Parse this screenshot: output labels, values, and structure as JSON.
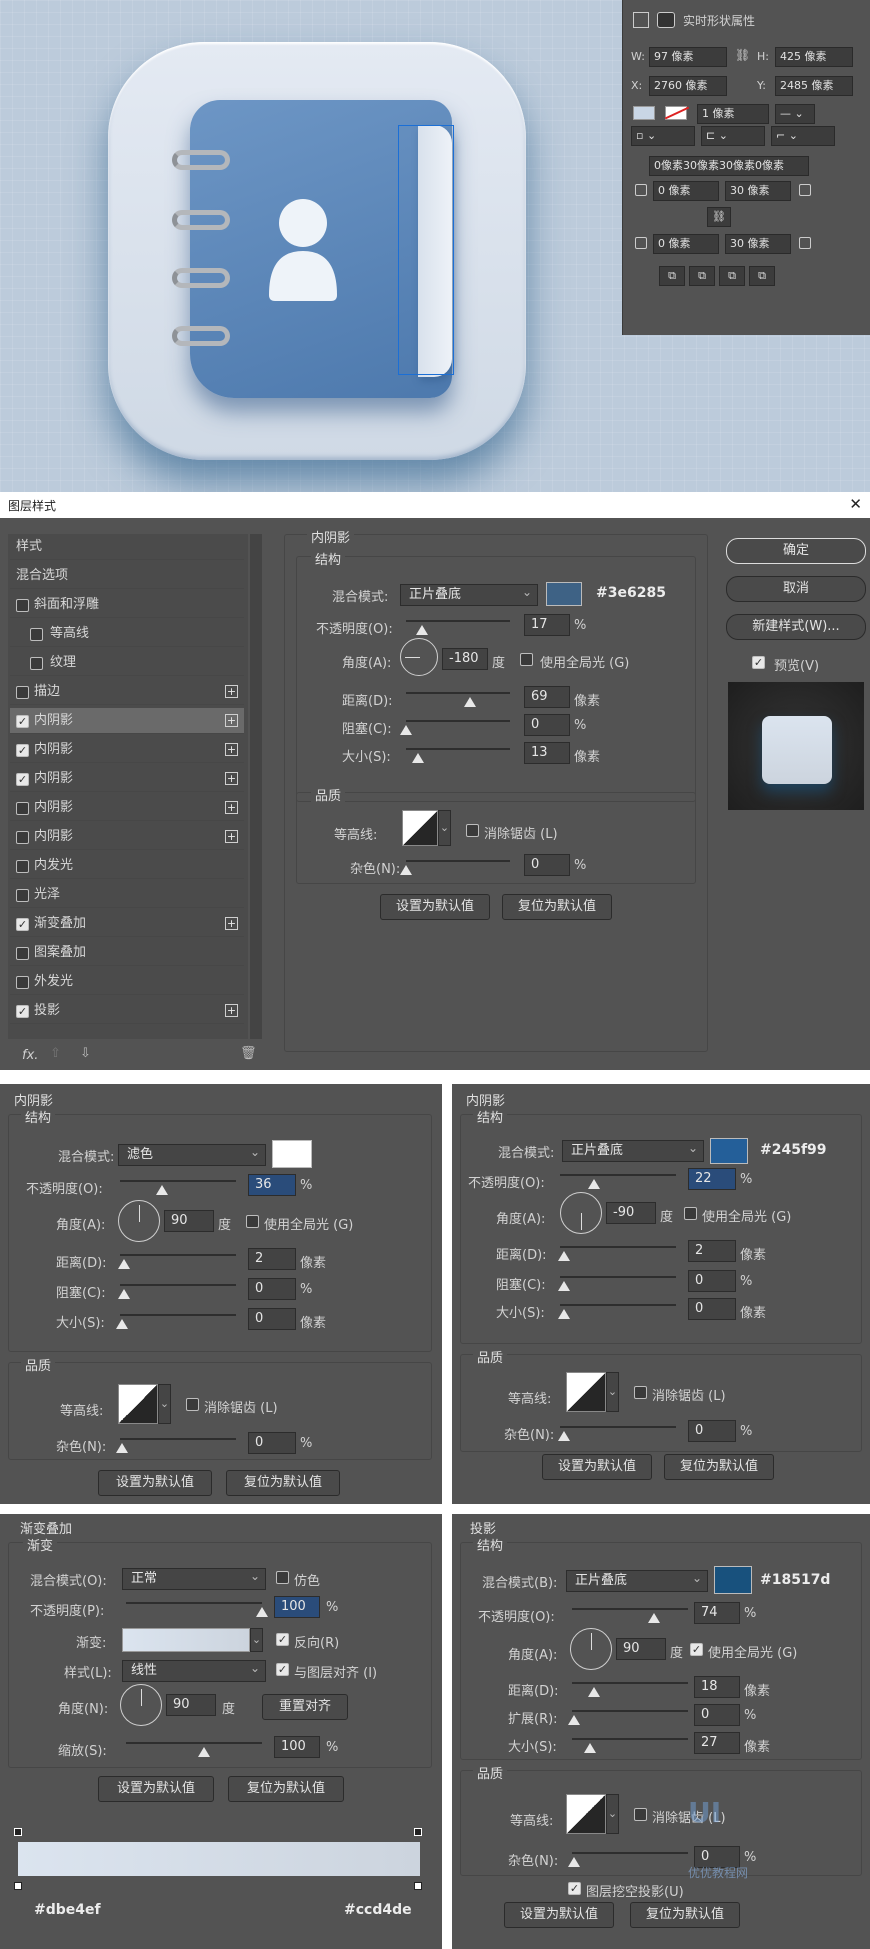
{
  "props_panel": {
    "title": "实时形状属性",
    "w_label": "W:",
    "w_value": "97 像素",
    "link_icon": "link-icon",
    "h_label": "H:",
    "h_value": "425 像素",
    "x_label": "X:",
    "x_value": "2760 像素",
    "y_label": "Y:",
    "y_value": "2485 像素",
    "stroke_width": "1 像素",
    "corner_all": "0像素30像素30像素0像素",
    "corner_tl": "0 像素",
    "corner_tr": "30 像素",
    "corner_bl": "0 像素",
    "corner_br": "30 像素"
  },
  "dialog": {
    "title": "图层样式",
    "close_label": "✕",
    "list": [
      {
        "label": "样式",
        "check": null,
        "plus": false
      },
      {
        "label": "混合选项",
        "check": null,
        "plus": false
      },
      {
        "label": "斜面和浮雕",
        "check": false,
        "plus": false
      },
      {
        "label": "等高线",
        "check": false,
        "plus": false,
        "indent": true
      },
      {
        "label": "纹理",
        "check": false,
        "plus": false,
        "indent": true
      },
      {
        "label": "描边",
        "check": false,
        "plus": true
      },
      {
        "label": "内阴影",
        "check": true,
        "plus": true,
        "active": true
      },
      {
        "label": "内阴影",
        "check": true,
        "plus": true
      },
      {
        "label": "内阴影",
        "check": true,
        "plus": true
      },
      {
        "label": "内阴影",
        "check": false,
        "plus": true
      },
      {
        "label": "内阴影",
        "check": false,
        "plus": true
      },
      {
        "label": "内发光",
        "check": false,
        "plus": false
      },
      {
        "label": "光泽",
        "check": false,
        "plus": false
      },
      {
        "label": "渐变叠加",
        "check": true,
        "plus": true
      },
      {
        "label": "图案叠加",
        "check": false,
        "plus": false
      },
      {
        "label": "外发光",
        "check": false,
        "plus": false
      },
      {
        "label": "投影",
        "check": true,
        "plus": true
      }
    ],
    "fx_label": "fx.",
    "ok": "确定",
    "cancel": "取消",
    "new_style": "新建样式(W)...",
    "preview_label": "预览(V)"
  },
  "main_inner_shadow": {
    "title": "内阴影",
    "structure": "结构",
    "blend_label": "混合模式:",
    "blend": "正片叠底",
    "color": "#3e6285",
    "hex": "#3e6285",
    "opacity_label": "不透明度(O):",
    "opacity": "17",
    "opacity_pct": 0.17,
    "angle_label": "角度(A):",
    "angle": "-180",
    "deg": "度",
    "global_label": "使用全局光 (G)",
    "distance_label": "距离(D):",
    "distance": "69",
    "distance_frac": 0.69,
    "choke_label": "阻塞(C):",
    "choke": "0",
    "size_label": "大小(S):",
    "size": "13",
    "size_frac": 0.13,
    "px": "像素",
    "pct": "%",
    "quality": "品质",
    "contour_label": "等高线:",
    "anti_alias": "消除锯齿 (L)",
    "noise_label": "杂色(N):",
    "noise": "0",
    "set_default": "设置为默认值",
    "reset_default": "复位为默认值"
  },
  "inner_shadow_2": {
    "title": "内阴影",
    "structure": "结构",
    "blend_label": "混合模式:",
    "blend": "滤色",
    "color": "#ffffff",
    "opacity_label": "不透明度(O):",
    "opacity": "36",
    "angle_label": "角度(A):",
    "angle": "90",
    "deg": "度",
    "global_label": "使用全局光 (G)",
    "distance_label": "距离(D):",
    "distance": "2",
    "choke_label": "阻塞(C):",
    "choke": "0",
    "size_label": "大小(S):",
    "size": "0",
    "px": "像素",
    "pct": "%",
    "quality": "品质",
    "contour_label": "等高线:",
    "anti_alias": "消除锯齿 (L)",
    "noise_label": "杂色(N):",
    "noise": "0",
    "set_default": "设置为默认值",
    "reset_default": "复位为默认值"
  },
  "inner_shadow_3": {
    "title": "内阴影",
    "structure": "结构",
    "blend_label": "混合模式:",
    "blend": "正片叠底",
    "color": "#245f99",
    "hex": "#245f99",
    "opacity_label": "不透明度(O):",
    "opacity": "22",
    "angle_label": "角度(A):",
    "angle": "-90",
    "deg": "度",
    "global_label": "使用全局光 (G)",
    "distance_label": "距离(D):",
    "distance": "2",
    "choke_label": "阻塞(C):",
    "choke": "0",
    "size_label": "大小(S):",
    "size": "0",
    "px": "像素",
    "pct": "%",
    "quality": "品质",
    "contour_label": "等高线:",
    "anti_alias": "消除锯齿 (L)",
    "noise_label": "杂色(N):",
    "noise": "0",
    "set_default": "设置为默认值",
    "reset_default": "复位为默认值"
  },
  "gradient_overlay": {
    "title": "渐变叠加",
    "gradient_group": "渐变",
    "blend_label": "混合模式(O):",
    "blend": "正常",
    "dither_label": "仿色",
    "opacity_label": "不透明度(P):",
    "opacity": "100",
    "pct": "%",
    "gradient_label": "渐变:",
    "reverse_label": "反向(R)",
    "style_label": "样式(L):",
    "style": "线性",
    "align_label": "与图层对齐 (I)",
    "angle_label": "角度(N):",
    "angle": "90",
    "deg": "度",
    "reset_align": "重置对齐",
    "scale_label": "缩放(S):",
    "scale": "100",
    "set_default": "设置为默认值",
    "reset_default": "复位为默认值",
    "stop_left": "#dbe4ef",
    "stop_right": "#ccd4de"
  },
  "drop_shadow": {
    "title": "投影",
    "structure": "结构",
    "blend_label": "混合模式(B):",
    "blend": "正片叠底",
    "color": "#18517d",
    "hex": "#18517d",
    "opacity_label": "不透明度(O):",
    "opacity": "74",
    "angle_label": "角度(A):",
    "angle": "90",
    "deg": "度",
    "global_label": "使用全局光 (G)",
    "distance_label": "距离(D):",
    "distance": "18",
    "spread_label": "扩展(R):",
    "spread": "0",
    "size_label": "大小(S):",
    "size": "27",
    "px": "像素",
    "pct": "%",
    "quality": "品质",
    "contour_label": "等高线:",
    "anti_alias": "消除锯齿 (L)",
    "noise_label": "杂色(N):",
    "noise": "0",
    "knockout_label": "图层挖空投影(U)",
    "set_default": "设置为默认值",
    "reset_default": "复位为默认值",
    "watermark": "优优教程网"
  }
}
